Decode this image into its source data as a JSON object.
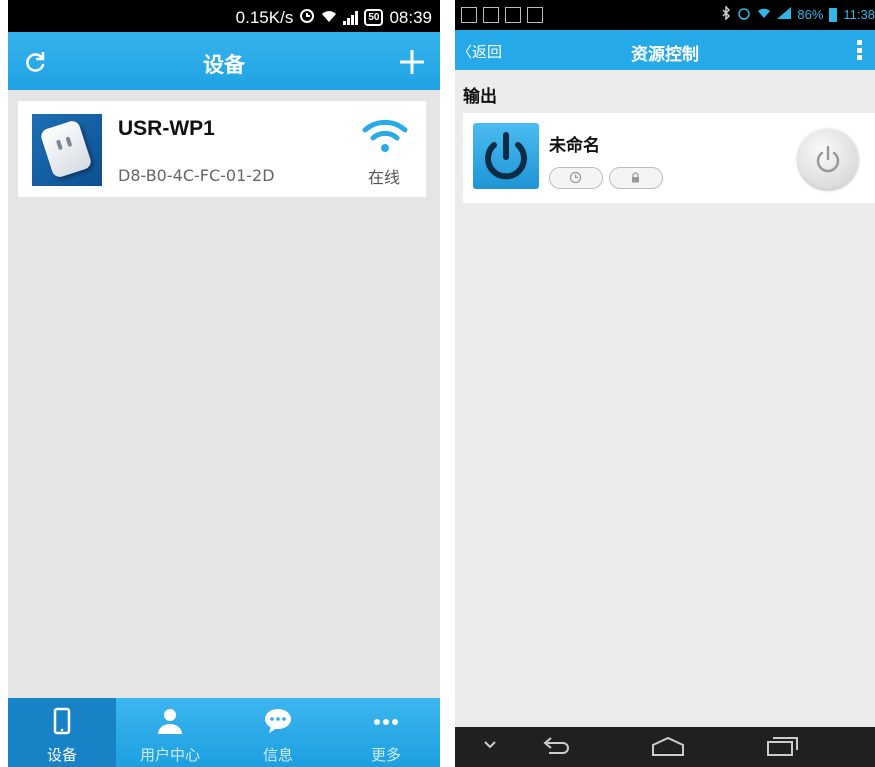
{
  "left_screen": {
    "status_bar": {
      "speed": "0.15K/s",
      "battery": "50",
      "time": "08:39"
    },
    "header": {
      "title": "设备",
      "refresh_icon": "refresh-icon",
      "add_icon": "plus-icon"
    },
    "device": {
      "name": "USR-WP1",
      "mac": "D8-B0-4C-FC-01-2D",
      "status": "在线",
      "signal_icon": "wifi-icon"
    },
    "tabs": [
      {
        "label": "设备",
        "icon": "phone-icon",
        "active": true
      },
      {
        "label": "用户中心",
        "icon": "user-icon",
        "active": false
      },
      {
        "label": "信息",
        "icon": "chat-icon",
        "active": false
      },
      {
        "label": "更多",
        "icon": "more-icon",
        "active": false
      }
    ],
    "colors": {
      "accent": "#2aaae6",
      "background": "#e5e5e5"
    }
  },
  "right_screen": {
    "status_bar": {
      "battery": "86%",
      "time": "11:38"
    },
    "header": {
      "back_label": "〈返回",
      "title": "资源控制"
    },
    "section_title": "输出",
    "resource": {
      "name": "未命名",
      "timer_icon": "clock-icon",
      "lock_icon": "lock-icon",
      "power_icon": "power-icon"
    },
    "nav_icons": [
      "chevron-down-icon",
      "back-icon",
      "home-icon",
      "recent-apps-icon"
    ]
  }
}
